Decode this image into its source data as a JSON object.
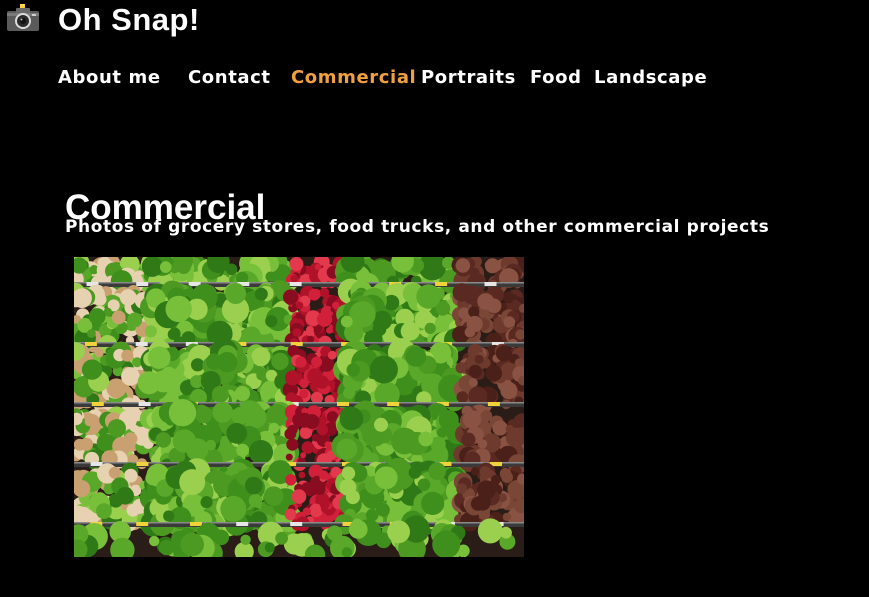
{
  "site": {
    "title": "Oh Snap!",
    "logo_icon": "camera-icon"
  },
  "nav": {
    "items": [
      {
        "label": "About me",
        "active": false
      },
      {
        "label": "Contact",
        "active": false
      },
      {
        "label": "Commercial",
        "active": true
      },
      {
        "label": "Portraits",
        "active": false
      },
      {
        "label": "Food",
        "active": false
      },
      {
        "label": "Landscape",
        "active": false
      }
    ]
  },
  "page": {
    "heading": "Commercial",
    "subtitle": "Photos of grocery stores, food trucks, and other commercial projects"
  },
  "photo": {
    "subject": "produce-shelves-photo"
  },
  "colors": {
    "background": "#000000",
    "text": "#ffffff",
    "active_nav": "#f0a040"
  }
}
